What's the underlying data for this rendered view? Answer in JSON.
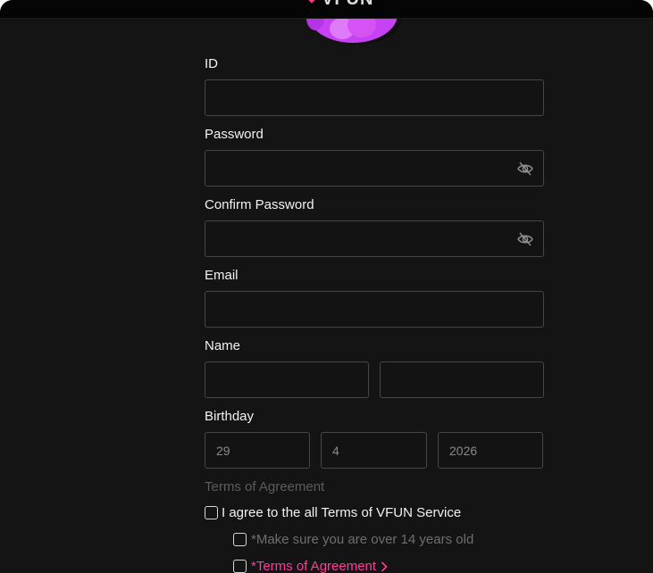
{
  "header": {
    "logo_text": "VFUN"
  },
  "form": {
    "id": {
      "label": "ID",
      "value": ""
    },
    "password": {
      "label": "Password",
      "value": ""
    },
    "confirm_password": {
      "label": "Confirm Password",
      "value": ""
    },
    "email": {
      "label": "Email",
      "value": ""
    },
    "name": {
      "label": "Name",
      "first_value": "",
      "last_value": ""
    },
    "birthday": {
      "label": "Birthday",
      "day": "29",
      "month": "4",
      "year": "2026"
    }
  },
  "terms": {
    "title": "Terms of Agreement",
    "agree_all": "I agree to the all Terms of VFUN Service",
    "age_check": "*Make sure you are over 14 years old",
    "terms_link": "*Terms of Agreement"
  },
  "colors": {
    "accent": "#ff3c9a",
    "background": "#141414",
    "field_border": "#474747"
  },
  "icons": {
    "password_toggle": "eye-off-icon",
    "terms_chevron": "chevron-right-icon",
    "mascot": "mascot-image"
  }
}
